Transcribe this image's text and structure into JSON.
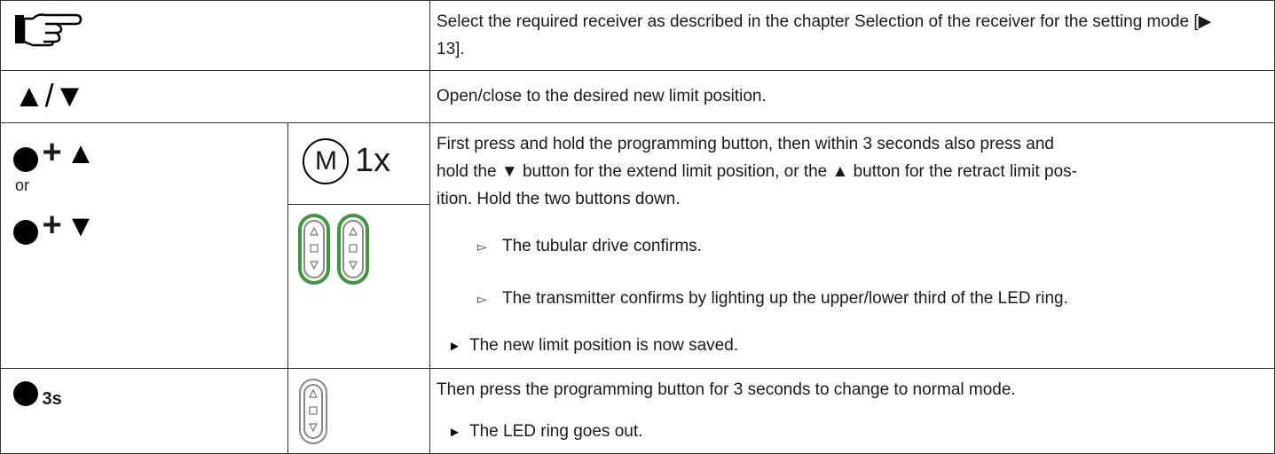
{
  "rows": {
    "r1": {
      "icon": "pointing-hand-icon",
      "description": "Select the required receiver as described in the chapter Selection of the receiver for the setting mode [▶ 13]."
    },
    "r2": {
      "symbols": "▲/▼",
      "description": "Open/close to the desired new limit position."
    },
    "r3": {
      "sym_up": "▲",
      "plus": "+",
      "or_text": "or",
      "sym_down": "▼",
      "m_label": "M",
      "count": "1x",
      "description_1": "First press and hold the programming button, then within 3 seconds also press and",
      "description_2": "hold the ▼ button for the extend limit position, or the ▲ button for the retract limit pos-",
      "description_3": "ition. Hold the two buttons down.",
      "result_1": "The tubular drive confirms.",
      "result_2": "The transmitter confirms by lighting up the upper/lower third of the LED ring.",
      "outcome": "The new limit position is now saved.",
      "remote_highlight_color": "#3a9a3a"
    },
    "r4": {
      "duration": "3s",
      "description": "Then press the programming button for 3 seconds to change to normal mode.",
      "outcome": "The LED ring goes out."
    }
  },
  "glyphs": {
    "result_marker": "▻",
    "outcome_marker": "►"
  }
}
